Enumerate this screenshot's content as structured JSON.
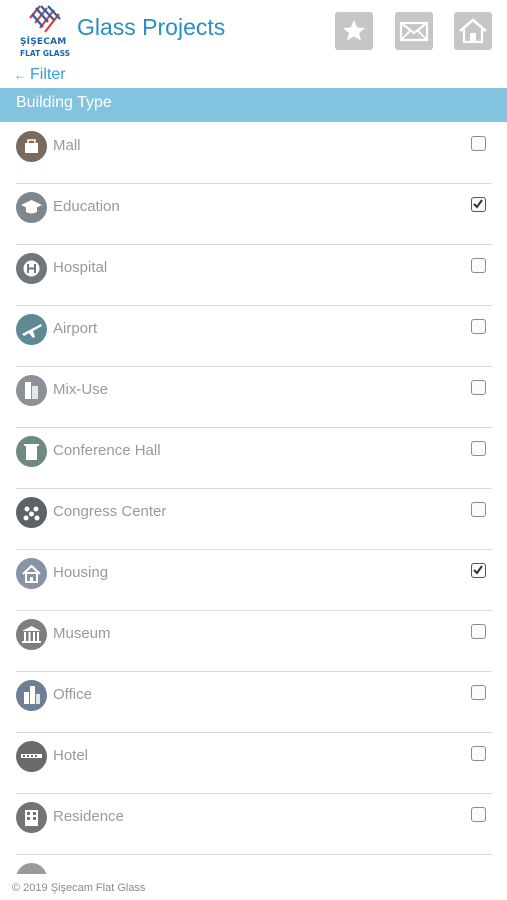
{
  "header": {
    "logo_line1": "ŞİŞECAM",
    "logo_line2": "FLAT GLASS",
    "title": "Glass Projects",
    "buttons": [
      {
        "icon": "star-icon",
        "label": "favorites"
      },
      {
        "icon": "mail-icon",
        "label": "contact"
      },
      {
        "icon": "home-icon",
        "label": "home"
      }
    ]
  },
  "filter": {
    "arrow": "←",
    "label": "Filter"
  },
  "section": {
    "title": "Building Type"
  },
  "items": [
    {
      "label": "Mall",
      "checked": false,
      "icon": "mall-icon"
    },
    {
      "label": "Education",
      "checked": true,
      "icon": "education-icon"
    },
    {
      "label": "Hospital",
      "checked": false,
      "icon": "hospital-icon"
    },
    {
      "label": "Airport",
      "checked": false,
      "icon": "airport-icon"
    },
    {
      "label": "Mix-Use",
      "checked": false,
      "icon": "mix-use-icon"
    },
    {
      "label": "Conference Hall",
      "checked": false,
      "icon": "conference-hall-icon"
    },
    {
      "label": "Congress Center",
      "checked": false,
      "icon": "congress-center-icon"
    },
    {
      "label": "Housing",
      "checked": true,
      "icon": "housing-icon"
    },
    {
      "label": "Museum",
      "checked": false,
      "icon": "museum-icon"
    },
    {
      "label": "Office",
      "checked": false,
      "icon": "office-icon"
    },
    {
      "label": "Hotel",
      "checked": false,
      "icon": "hotel-icon"
    },
    {
      "label": "Residence",
      "checked": false,
      "icon": "residence-icon"
    }
  ],
  "footer": {
    "text": "© 2019 Şişecam Flat Glass"
  },
  "colors": {
    "accent": "#2a8fbf",
    "section_bar": "#82c4e0",
    "header_button": "#c4c6c7"
  }
}
